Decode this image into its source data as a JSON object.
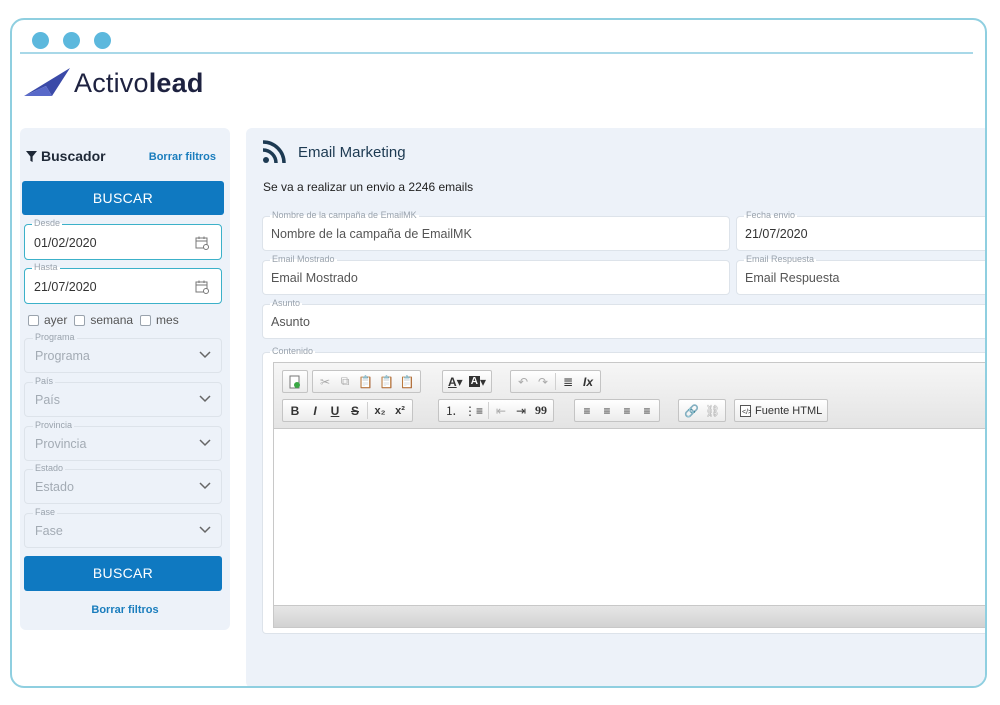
{
  "brand": {
    "name_light": "Activo",
    "name_bold": "lead",
    "accent": "#3b4aa8"
  },
  "sidebar": {
    "title": "Buscador",
    "clear_filters": "Borrar filtros",
    "search_button": "BUSCAR",
    "desde": {
      "label": "Desde",
      "value": "01/02/2020"
    },
    "hasta": {
      "label": "Hasta",
      "value": "21/07/2020"
    },
    "quick_ranges": [
      "ayer",
      "semana",
      "mes"
    ],
    "selects": [
      {
        "label": "Programa",
        "value": "Programa"
      },
      {
        "label": "País",
        "value": "País"
      },
      {
        "label": "Provincia",
        "value": "Provincia"
      },
      {
        "label": "Estado",
        "value": "Estado"
      },
      {
        "label": "Fase",
        "value": "Fase"
      }
    ],
    "search_button_bottom": "BUSCAR",
    "clear_filters_bottom": "Borrar filtros"
  },
  "main": {
    "title": "Email Marketing",
    "info": "Se va a realizar un envio a 2246 emails",
    "campaign_name": {
      "label": "Nombre de la campaña de EmailMK",
      "placeholder": "Nombre de la campaña de EmailMK"
    },
    "send_date": {
      "label": "Fecha envio",
      "value": "21/07/2020"
    },
    "shown_email": {
      "label": "Email Mostrado",
      "placeholder": "Email Mostrado"
    },
    "reply_email": {
      "label": "Email Respuesta",
      "placeholder": "Email Respuesta"
    },
    "subject": {
      "label": "Asunto",
      "placeholder": "Asunto"
    },
    "content": {
      "label": "Contenido"
    },
    "editor": {
      "row1": [
        "new-page",
        "cut",
        "copy",
        "paste",
        "paste-text",
        "paste-word",
        "text-color",
        "bg-color",
        "undo",
        "redo",
        "remove-block",
        "remove-format"
      ],
      "text_color_label": "A",
      "bg_color_label": "A",
      "remove_format_label": "Ix",
      "bold": "B",
      "italic": "I",
      "underline": "U",
      "strike": "S",
      "sub": "x₂",
      "sup": "x²",
      "blockquote": "99",
      "source_html": "Fuente HTML"
    }
  }
}
